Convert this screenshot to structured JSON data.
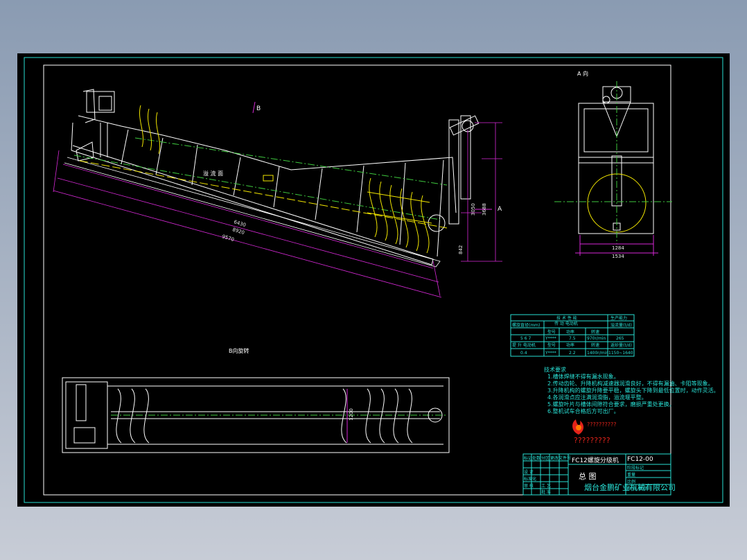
{
  "drawing": {
    "view_a_label": "A 向",
    "view_b_label": "B向旋转",
    "marker_b": "B",
    "marker_a": "A",
    "overflow_label": "溢 流 面",
    "dims": {
      "d1": "6430",
      "d2": "8920",
      "d3": "9570",
      "d4": "3050",
      "d5": "3688",
      "d6": "842",
      "d7": "1200",
      "w1": "1284",
      "w2": "1534"
    }
  },
  "spec_table": {
    "title": "技  术  性  能",
    "header_right": "生产能力",
    "row1": {
      "c1": "螺旋直径(mm)",
      "c2": "传 动 电动机",
      "c3": "溢流量(t/d)"
    },
    "row2": {
      "c1": "型号",
      "c2": "功率",
      "c3": "转速"
    },
    "row3": {
      "c1": "5 6 7",
      "c2": "Y****",
      "c3": "7.5",
      "c4": "970r/min",
      "c5": "265"
    },
    "row4": {
      "c1": "提 升 电动机",
      "c2": "返砂量(t/d)"
    },
    "row5": {
      "c1": "型号",
      "c2": "功率",
      "c3": "转速"
    },
    "row6": {
      "c1": "0.4",
      "c2": "Y****",
      "c3": "2.2",
      "c4": "1400r/min",
      "c5": "1150~1640"
    }
  },
  "tech_notes": {
    "title": "技术要求",
    "lines": [
      "1.槽体焊缝不得有漏水现象。",
      "2.传动齿轮、升降机构减速器润滑良好，不得有漏油、卡阻等现象。",
      "3.升降机构的螺旋升降要平稳，螺旋头下降到最低位置时，动作灵活。",
      "4.各润滑点应注满润滑脂，溢流堰平整。",
      "5.螺旋叶片与槽体间隙符合要求，磨损严重处更换。",
      "6.整机试车合格后方可出厂。"
    ]
  },
  "logo_text": "??????????",
  "logo_subtitle": "?????????",
  "title_block": {
    "product": "FC12螺旋分级机",
    "drawing_no": "FC12-00",
    "drawing_name": "总  图",
    "company": "烟台金鹏矿业机械有限公司",
    "rows": [
      "标记",
      "处数",
      "分区",
      "更改文件号",
      "签名",
      "年月日"
    ],
    "design": "设 计",
    "std": "标准化",
    "check": "审 核",
    "process": "工 艺",
    "approve": "批 准",
    "stage": "阶段标记",
    "weight": "重量",
    "scale": "比例",
    "sheet": "共 张  第 张"
  },
  "colors": {
    "frame": "#29e0d5",
    "structure": "#ffffff",
    "spiral": "#f2e600",
    "dimension": "#d829d8",
    "center": "#3ec93e"
  }
}
